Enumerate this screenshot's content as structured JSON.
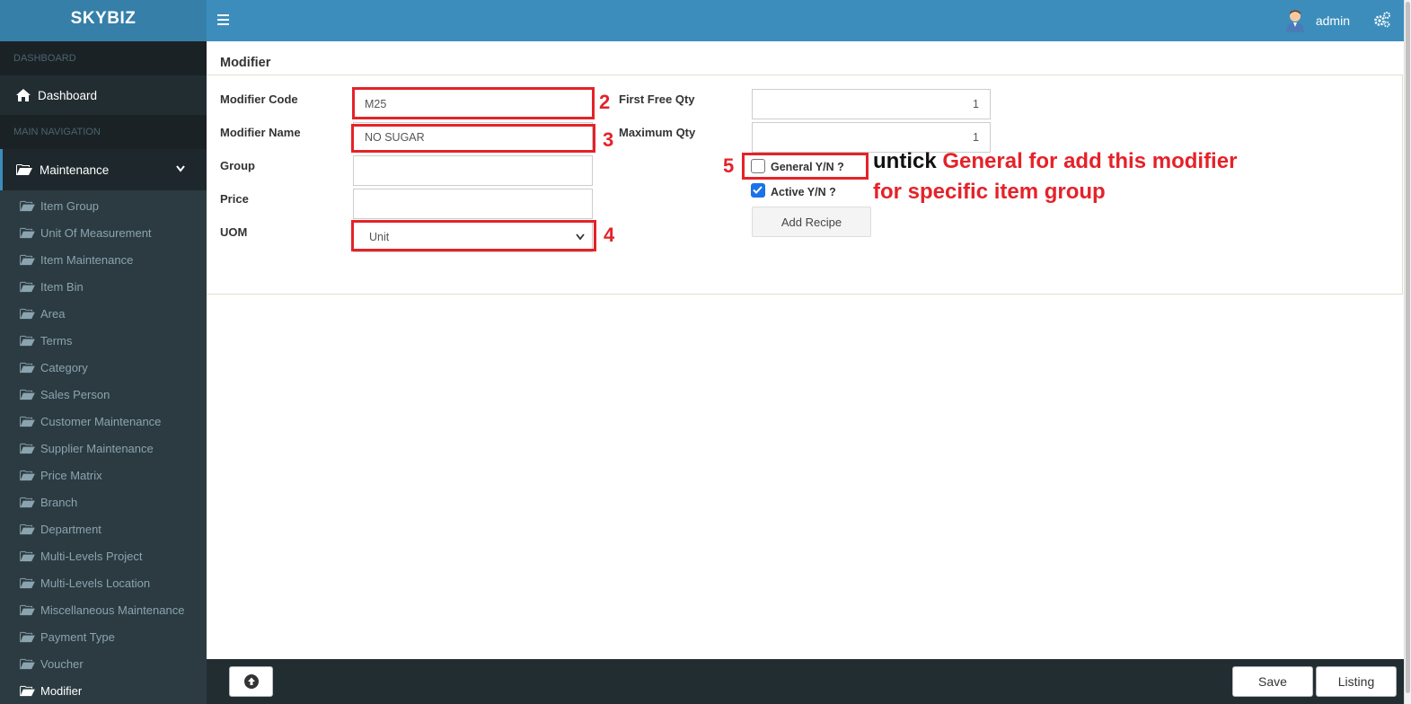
{
  "app": {
    "logo": "SKYBIZ"
  },
  "header": {
    "user_name": "admin"
  },
  "sidebar": {
    "section_dashboard": "DASHBOARD",
    "dashboard_label": "Dashboard",
    "section_main": "MAIN NAVIGATION",
    "maintenance_label": "Maintenance",
    "items": [
      {
        "label": "Item Group"
      },
      {
        "label": "Unit Of Measurement"
      },
      {
        "label": "Item Maintenance"
      },
      {
        "label": "Item Bin"
      },
      {
        "label": "Area"
      },
      {
        "label": "Terms"
      },
      {
        "label": "Category"
      },
      {
        "label": "Sales Person"
      },
      {
        "label": "Customer Maintenance"
      },
      {
        "label": "Supplier Maintenance"
      },
      {
        "label": "Price Matrix"
      },
      {
        "label": "Branch"
      },
      {
        "label": "Department"
      },
      {
        "label": "Multi-Levels Project"
      },
      {
        "label": "Multi-Levels Location"
      },
      {
        "label": "Miscellaneous Maintenance"
      },
      {
        "label": "Payment Type"
      },
      {
        "label": "Voucher"
      },
      {
        "label": "Modifier"
      }
    ],
    "active_item": "Modifier"
  },
  "form": {
    "title": "Modifier",
    "modifier_code_label": "Modifier Code",
    "modifier_code_value": "M25",
    "modifier_name_label": "Modifier Name",
    "modifier_name_value": "NO SUGAR",
    "group_label": "Group",
    "group_value": "",
    "price_label": "Price",
    "price_value": "",
    "uom_label": "UOM",
    "uom_value": "Unit",
    "first_free_qty_label": "First Free Qty",
    "first_free_qty_value": "1",
    "maximum_qty_label": "Maximum Qty",
    "maximum_qty_value": "1",
    "general_label": "General Y/N ?",
    "general_checked": false,
    "active_label": "Active Y/N ?",
    "active_checked": true,
    "add_recipe_label": "Add Recipe"
  },
  "annotations": {
    "num_2": "2",
    "num_3": "3",
    "num_4": "4",
    "num_5": "5",
    "note_black": "untick",
    "note_red": "General for add this modifier for specific item group",
    "color": "#e52229"
  },
  "footer": {
    "save_label": "Save",
    "listing_label": "Listing"
  },
  "colors": {
    "header": "#3c8dbc",
    "logo_bg": "#367fa9",
    "sidebar_bg": "#222d32"
  }
}
